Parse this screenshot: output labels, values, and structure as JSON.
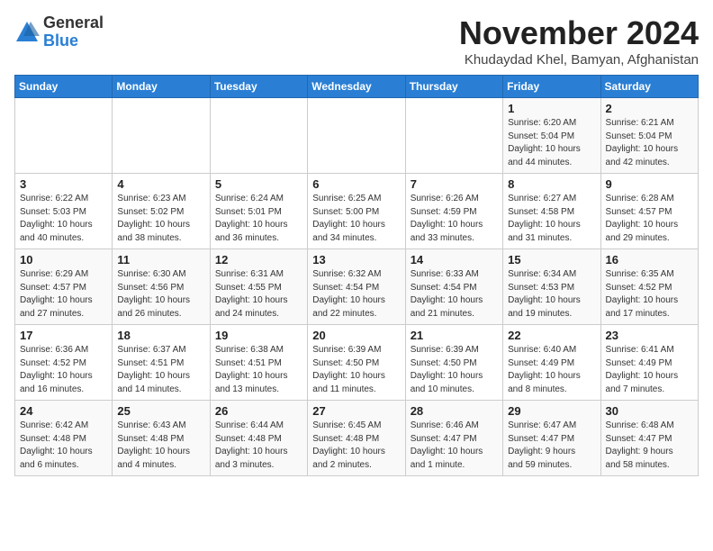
{
  "logo": {
    "general": "General",
    "blue": "Blue"
  },
  "title": "November 2024",
  "subtitle": "Khudaydad Khel, Bamyan, Afghanistan",
  "days_of_week": [
    "Sunday",
    "Monday",
    "Tuesday",
    "Wednesday",
    "Thursday",
    "Friday",
    "Saturday"
  ],
  "weeks": [
    [
      {
        "day": "",
        "info": ""
      },
      {
        "day": "",
        "info": ""
      },
      {
        "day": "",
        "info": ""
      },
      {
        "day": "",
        "info": ""
      },
      {
        "day": "",
        "info": ""
      },
      {
        "day": "1",
        "info": "Sunrise: 6:20 AM\nSunset: 5:04 PM\nDaylight: 10 hours\nand 44 minutes."
      },
      {
        "day": "2",
        "info": "Sunrise: 6:21 AM\nSunset: 5:04 PM\nDaylight: 10 hours\nand 42 minutes."
      }
    ],
    [
      {
        "day": "3",
        "info": "Sunrise: 6:22 AM\nSunset: 5:03 PM\nDaylight: 10 hours\nand 40 minutes."
      },
      {
        "day": "4",
        "info": "Sunrise: 6:23 AM\nSunset: 5:02 PM\nDaylight: 10 hours\nand 38 minutes."
      },
      {
        "day": "5",
        "info": "Sunrise: 6:24 AM\nSunset: 5:01 PM\nDaylight: 10 hours\nand 36 minutes."
      },
      {
        "day": "6",
        "info": "Sunrise: 6:25 AM\nSunset: 5:00 PM\nDaylight: 10 hours\nand 34 minutes."
      },
      {
        "day": "7",
        "info": "Sunrise: 6:26 AM\nSunset: 4:59 PM\nDaylight: 10 hours\nand 33 minutes."
      },
      {
        "day": "8",
        "info": "Sunrise: 6:27 AM\nSunset: 4:58 PM\nDaylight: 10 hours\nand 31 minutes."
      },
      {
        "day": "9",
        "info": "Sunrise: 6:28 AM\nSunset: 4:57 PM\nDaylight: 10 hours\nand 29 minutes."
      }
    ],
    [
      {
        "day": "10",
        "info": "Sunrise: 6:29 AM\nSunset: 4:57 PM\nDaylight: 10 hours\nand 27 minutes."
      },
      {
        "day": "11",
        "info": "Sunrise: 6:30 AM\nSunset: 4:56 PM\nDaylight: 10 hours\nand 26 minutes."
      },
      {
        "day": "12",
        "info": "Sunrise: 6:31 AM\nSunset: 4:55 PM\nDaylight: 10 hours\nand 24 minutes."
      },
      {
        "day": "13",
        "info": "Sunrise: 6:32 AM\nSunset: 4:54 PM\nDaylight: 10 hours\nand 22 minutes."
      },
      {
        "day": "14",
        "info": "Sunrise: 6:33 AM\nSunset: 4:54 PM\nDaylight: 10 hours\nand 21 minutes."
      },
      {
        "day": "15",
        "info": "Sunrise: 6:34 AM\nSunset: 4:53 PM\nDaylight: 10 hours\nand 19 minutes."
      },
      {
        "day": "16",
        "info": "Sunrise: 6:35 AM\nSunset: 4:52 PM\nDaylight: 10 hours\nand 17 minutes."
      }
    ],
    [
      {
        "day": "17",
        "info": "Sunrise: 6:36 AM\nSunset: 4:52 PM\nDaylight: 10 hours\nand 16 minutes."
      },
      {
        "day": "18",
        "info": "Sunrise: 6:37 AM\nSunset: 4:51 PM\nDaylight: 10 hours\nand 14 minutes."
      },
      {
        "day": "19",
        "info": "Sunrise: 6:38 AM\nSunset: 4:51 PM\nDaylight: 10 hours\nand 13 minutes."
      },
      {
        "day": "20",
        "info": "Sunrise: 6:39 AM\nSunset: 4:50 PM\nDaylight: 10 hours\nand 11 minutes."
      },
      {
        "day": "21",
        "info": "Sunrise: 6:39 AM\nSunset: 4:50 PM\nDaylight: 10 hours\nand 10 minutes."
      },
      {
        "day": "22",
        "info": "Sunrise: 6:40 AM\nSunset: 4:49 PM\nDaylight: 10 hours\nand 8 minutes."
      },
      {
        "day": "23",
        "info": "Sunrise: 6:41 AM\nSunset: 4:49 PM\nDaylight: 10 hours\nand 7 minutes."
      }
    ],
    [
      {
        "day": "24",
        "info": "Sunrise: 6:42 AM\nSunset: 4:48 PM\nDaylight: 10 hours\nand 6 minutes."
      },
      {
        "day": "25",
        "info": "Sunrise: 6:43 AM\nSunset: 4:48 PM\nDaylight: 10 hours\nand 4 minutes."
      },
      {
        "day": "26",
        "info": "Sunrise: 6:44 AM\nSunset: 4:48 PM\nDaylight: 10 hours\nand 3 minutes."
      },
      {
        "day": "27",
        "info": "Sunrise: 6:45 AM\nSunset: 4:48 PM\nDaylight: 10 hours\nand 2 minutes."
      },
      {
        "day": "28",
        "info": "Sunrise: 6:46 AM\nSunset: 4:47 PM\nDaylight: 10 hours\nand 1 minute."
      },
      {
        "day": "29",
        "info": "Sunrise: 6:47 AM\nSunset: 4:47 PM\nDaylight: 9 hours\nand 59 minutes."
      },
      {
        "day": "30",
        "info": "Sunrise: 6:48 AM\nSunset: 4:47 PM\nDaylight: 9 hours\nand 58 minutes."
      }
    ]
  ]
}
